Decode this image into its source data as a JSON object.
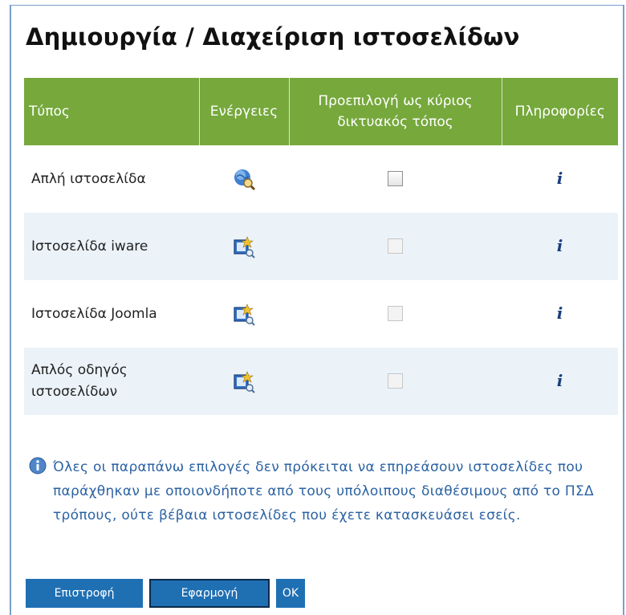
{
  "title": "Δημιουργία / Διαχείριση ιστοσελίδων",
  "table": {
    "headers": {
      "type": "Τύπος",
      "actions": "Ενέργειες",
      "default": "Προεπιλογή ως κύριος δικτυακός τόπος",
      "info": "Πληροφορίες"
    },
    "rows": [
      {
        "type": "Απλή ιστοσελίδα",
        "action_icon": "globe-search-icon",
        "checkbox_enabled": true,
        "checked": false,
        "info_icon": "info-i-icon"
      },
      {
        "type": "Ιστοσελίδα iware",
        "action_icon": "folder-wizard-icon",
        "checkbox_enabled": false,
        "checked": false,
        "info_icon": "info-i-icon"
      },
      {
        "type": "Ιστοσελίδα Joomla",
        "action_icon": "folder-wizard-icon",
        "checkbox_enabled": false,
        "checked": false,
        "info_icon": "info-i-icon"
      },
      {
        "type": "Απλός οδηγός ιστοσελίδων",
        "action_icon": "folder-wizard-icon",
        "checkbox_enabled": false,
        "checked": false,
        "info_icon": "info-i-icon"
      }
    ]
  },
  "note": {
    "icon": "info-circle-icon",
    "text": "Όλες οι παραπάνω επιλογές δεν πρόκειται να επηρεάσουν ιστοσελίδες που παράχθηκαν με οποιονδήποτε από τους υπόλοιπους διαθέσιμους από το ΠΣΔ τρόπους, ούτε βέβαια ιστοσελίδες που έχετε κατασκευάσει εσείς."
  },
  "buttons": {
    "back": "Επιστροφή",
    "apply": "Εφαρμογή",
    "ok": "OK"
  },
  "colors": {
    "header_bg": "#76a83c",
    "alt_row_bg": "#ebf3f9",
    "button_bg": "#1f6fb3",
    "note_text": "#2b62a3",
    "frame_border": "#7a9fc9"
  }
}
